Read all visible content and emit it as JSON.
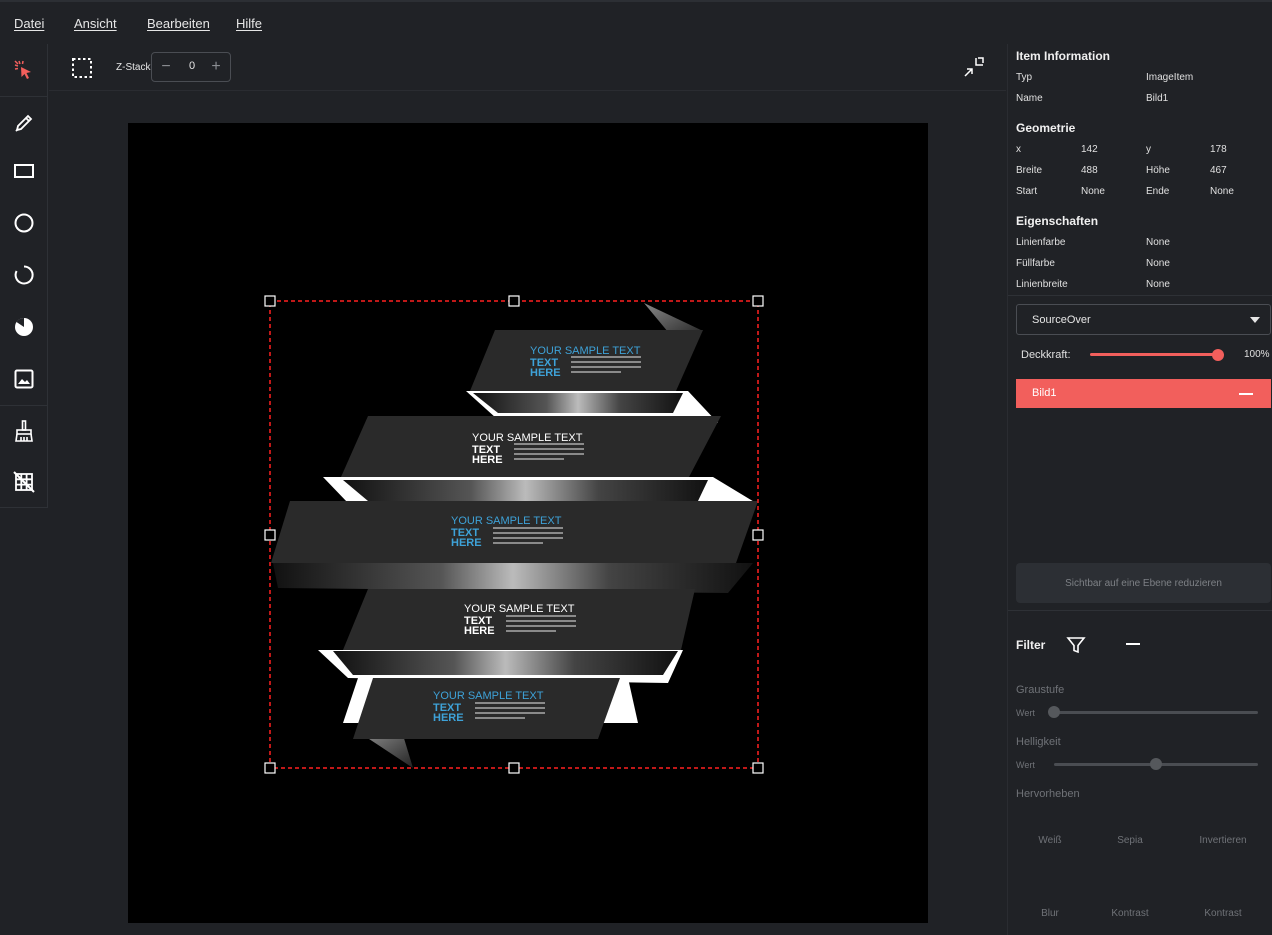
{
  "menu": [
    "Datei",
    "Ansicht",
    "Bearbeiten",
    "Hilfe"
  ],
  "toolbar": {
    "zstack_label": "Z-Stack",
    "zstack_value": "0"
  },
  "item_info": {
    "title": "Item Information",
    "typ_label": "Typ",
    "typ_value": "ImageItem",
    "name_label": "Name",
    "name_value": "Bild1"
  },
  "geometry": {
    "title": "Geometrie",
    "x_label": "x",
    "x_value": "142",
    "y_label": "y",
    "y_value": "178",
    "width_label": "Breite",
    "width_value": "488",
    "height_label": "Höhe",
    "height_value": "467",
    "start_label": "Start",
    "start_value": "None",
    "end_label": "Ende",
    "end_value": "None"
  },
  "properties": {
    "title": "Eigenschaften",
    "linecolor_label": "Linienfarbe",
    "linecolor_value": "None",
    "fillcolor_label": "Füllfarbe",
    "fillcolor_value": "None",
    "linewidth_label": "Linienbreite",
    "linewidth_value": "None"
  },
  "blend_mode": "SourceOver",
  "opacity": {
    "label": "Deckkraft:",
    "value_text": "100%",
    "value": 1.0
  },
  "layer": {
    "name": "Bild1"
  },
  "flatten_button": "Sichtbar auf eine Ebene reduzieren",
  "filter": {
    "title": "Filter",
    "grayscale_label": "Graustufe",
    "grayscale_value_label": "Wert",
    "grayscale_value": 0.0,
    "brightness_label": "Helligkeit",
    "brightness_value_label": "Wert",
    "brightness_value": 0.5,
    "highlight_label": "Hervorheben",
    "buttons_row1": [
      "Weiß",
      "Sepia",
      "Invertieren"
    ],
    "buttons_row2": [
      "Blur",
      "Kontrast",
      "Kontrast"
    ]
  },
  "banners": [
    {
      "title": "YOUR SAMPLE TEXT",
      "sub1": "TEXT",
      "sub2": "HERE",
      "color": "#3ea2d8"
    },
    {
      "title": "YOUR SAMPLE TEXT",
      "sub1": "TEXT",
      "sub2": "HERE",
      "color": "#ffffff"
    },
    {
      "title": "YOUR SAMPLE TEXT",
      "sub1": "TEXT",
      "sub2": "HERE",
      "color": "#3ea2d8"
    },
    {
      "title": "YOUR SAMPLE TEXT",
      "sub1": "TEXT",
      "sub2": "HERE",
      "color": "#ffffff"
    },
    {
      "title": "YOUR SAMPLE TEXT",
      "sub1": "TEXT",
      "sub2": "HERE",
      "color": "#3ea2d8"
    }
  ],
  "colors": {
    "accent": "#f25f5c",
    "selection": "#ff2020",
    "background": "#202226"
  }
}
